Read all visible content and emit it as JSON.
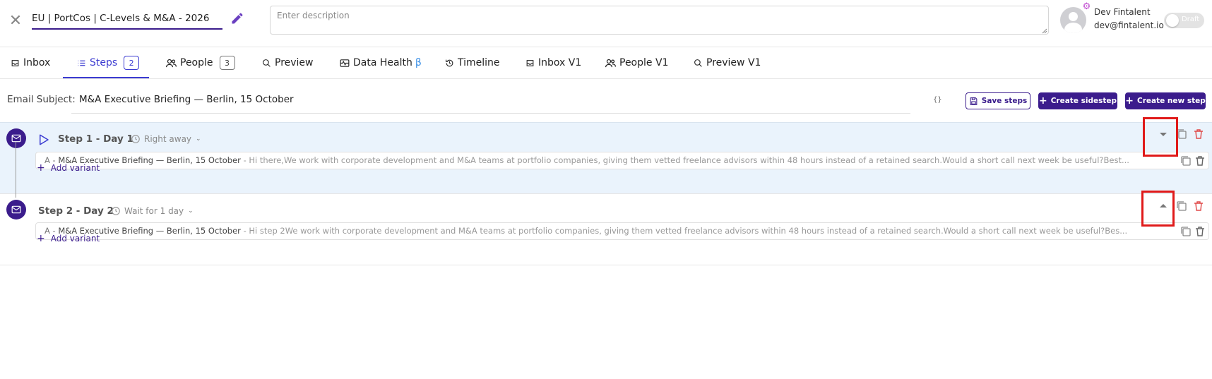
{
  "header": {
    "close_icon": "close-icon",
    "title": "EU | PortCos | C-Levels & M&A - 2026",
    "edit_icon": "pencil-icon",
    "description_placeholder": "Enter description",
    "description_value": ""
  },
  "user": {
    "name": "Dev Fintalent",
    "email": "dev@fintalent.io",
    "status_label": "Draft",
    "status_on": false
  },
  "tabs": [
    {
      "label": "Inbox",
      "icon": "inbox-icon",
      "active": false
    },
    {
      "label": "Steps",
      "icon": "list-icon",
      "active": true,
      "count": "2"
    },
    {
      "label": "People",
      "icon": "people-icon",
      "active": false,
      "count": "3"
    },
    {
      "label": "Preview",
      "icon": "search-icon",
      "active": false
    },
    {
      "label": "Data Health",
      "icon": "data-health-icon",
      "active": false,
      "badge": "β"
    },
    {
      "label": "Timeline",
      "icon": "history-icon",
      "active": false
    },
    {
      "label": "Inbox V1",
      "icon": "inbox-icon",
      "active": false
    },
    {
      "label": "People V1",
      "icon": "people-icon",
      "active": false
    },
    {
      "label": "Preview V1",
      "icon": "search-icon",
      "active": false
    }
  ],
  "subject": {
    "label": "Email Subject:",
    "value": "M&A Executive Briefing — Berlin, 15 October",
    "variables_label": "{}"
  },
  "actions": {
    "save_steps": "Save steps",
    "create_sidestep": "Create sidestep",
    "create_new_step": "Create new step"
  },
  "steps": [
    {
      "title": "Step 1 - Day 1",
      "timing": "Right away",
      "expanded": true,
      "variant": {
        "prefix": "A - ",
        "subject": "M&A Executive Briefing — Berlin, 15 October",
        "body": " - Hi there,We work with corporate development and M&A teams at portfolio companies, giving them vetted freelance advisors within 48 hours instead of a retained search.Would a short call next week be useful?Best..."
      },
      "add_variant": "Add variant"
    },
    {
      "title": "Step 2 - Day 2",
      "timing": "Wait for 1 day",
      "expanded": false,
      "variant": {
        "prefix": "A - ",
        "subject": "M&A Executive Briefing — Berlin, 15 October",
        "body": " - Hi step 2We work with corporate development and M&A teams at portfolio companies, giving them vetted freelance advisors within 48 hours instead of a retained search.Would a short call next week be useful?Bes..."
      },
      "add_variant": "Add variant"
    }
  ],
  "colors": {
    "primary": "#3b1c8c",
    "tab_active": "#3b3bd1",
    "step_active_bg": "#eaf3fc",
    "delete": "#e04848",
    "highlight": "#e01a1a"
  }
}
